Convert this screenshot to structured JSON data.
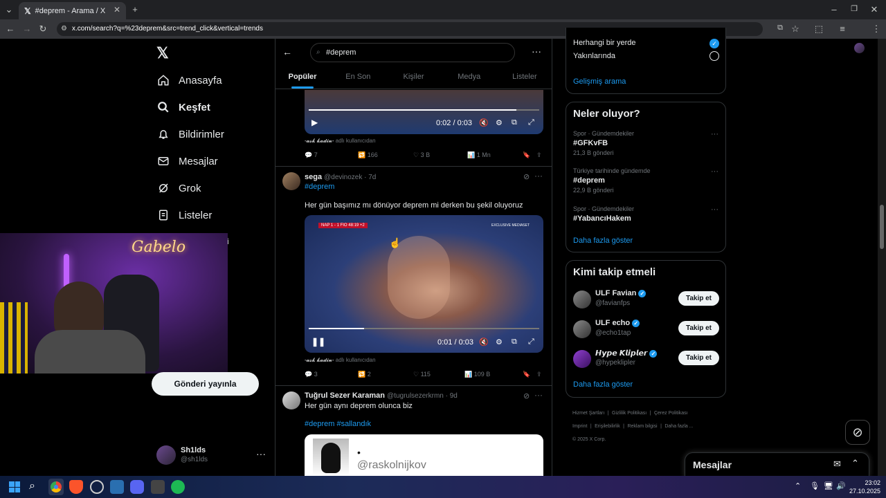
{
  "browser": {
    "tab_title": "#deprem - Arama / X",
    "url": "x.com/search?q=%23deprem&src=trend_click&vertical=trends"
  },
  "nav": {
    "logo": "𝕏",
    "items": [
      {
        "label": "Anasayfa",
        "icon": "home-icon"
      },
      {
        "label": "Keşfet",
        "icon": "search-icon"
      },
      {
        "label": "Bildirimler",
        "icon": "bell-icon"
      },
      {
        "label": "Mesajlar",
        "icon": "mail-icon"
      },
      {
        "label": "Grok",
        "icon": "grok-icon"
      },
      {
        "label": "Listeler",
        "icon": "list-icon"
      }
    ],
    "post_button": "Gönderi yayınla",
    "profile_name": "Sh1lds",
    "profile_handle": "@sh1lds"
  },
  "webcam": {
    "neon_text": "Gabelo"
  },
  "search": {
    "query": "#deprem"
  },
  "tabs": [
    "Popüler",
    "En Son",
    "Kişiler",
    "Medya",
    "Listeler"
  ],
  "tweet1": {
    "time": "0:02 / 0:03",
    "progress": 0.9,
    "source_name": "-𝓪𝓼𝓴 𝓴𝓪𝓭𝓲𝓷-",
    "source_suffix": "adlı kullanıcıdan",
    "replies": "7",
    "reposts": "166",
    "likes": "3 B",
    "views": "1 Mn"
  },
  "tweet2": {
    "name": "sega",
    "handle": "@devinozek · 7d",
    "hashtag": "#deprem",
    "text": "Her gün başımız mı dönüyor deprem mi derken bu şekil oluyoruz",
    "scoreboard": "NAP  1 - 1  FIO  48:19  +2",
    "watermark": "EXCLUSIVE MEDIASET",
    "time": "0:01 / 0:03",
    "progress": 0.24,
    "source_name": "-𝓪𝓼𝓴 𝓴𝓪𝓭𝓲𝓷-",
    "source_suffix": "adlı kullanıcıdan",
    "replies": "3",
    "reposts": "2",
    "likes": "115",
    "views": "109 B"
  },
  "tweet3": {
    "name": "Tuğrul Sezer Karaman",
    "handle": "@tugrulsezerkrmn · 9d",
    "text": "Her gün aynı deprem olunca biz",
    "hashtags": "#deprem #sallandık",
    "embed_dot": "•",
    "embed_handle": "@raskolnijkov"
  },
  "location": {
    "opt1": "Herhangi bir yerde",
    "opt2": "Yakınlarında",
    "advanced": "Gelişmiş arama"
  },
  "trends": {
    "title": "Neler oluyor?",
    "items": [
      {
        "category": "Spor · Gündemdekiler",
        "name": "#GFKvFB",
        "count": "21,3 B gönderi"
      },
      {
        "category": "Türkiye tarihinde gündemde",
        "name": "#deprem",
        "count": "22,9 B gönderi"
      },
      {
        "category": "Spor · Gündemdekiler",
        "name": "#YabancıHakem",
        "count": ""
      }
    ],
    "more": "Daha fazla göster"
  },
  "follow": {
    "title": "Kimi takip etmeli",
    "items": [
      {
        "name": "ULF Favian",
        "handle": "@favianfps",
        "button": "Takip et"
      },
      {
        "name": "ULF echo",
        "handle": "@echo1tap",
        "button": "Takip et"
      },
      {
        "name": "𝙃𝙮𝙥𝙚 𝙆𝙡𝙞𝙥𝙡𝙚𝙧",
        "handle": "@hypeklipler",
        "button": "Takip et"
      }
    ],
    "more": "Daha fazla göster"
  },
  "footer": {
    "links": [
      "Hizmet Şartları",
      "Gizlilik Politikası",
      "Çerez Politikası",
      "Imprint",
      "Erişilebilirlik",
      "Reklam bilgisi",
      "Daha fazla ..."
    ],
    "copyright": "© 2025 X Corp."
  },
  "messages_drawer": {
    "title": "Mesajlar"
  },
  "taskbar": {
    "time": "23:02",
    "date": "27.10.2025"
  },
  "colors": {
    "accent": "#1d9bf0",
    "bg": "#000000",
    "border": "#2f3336"
  }
}
